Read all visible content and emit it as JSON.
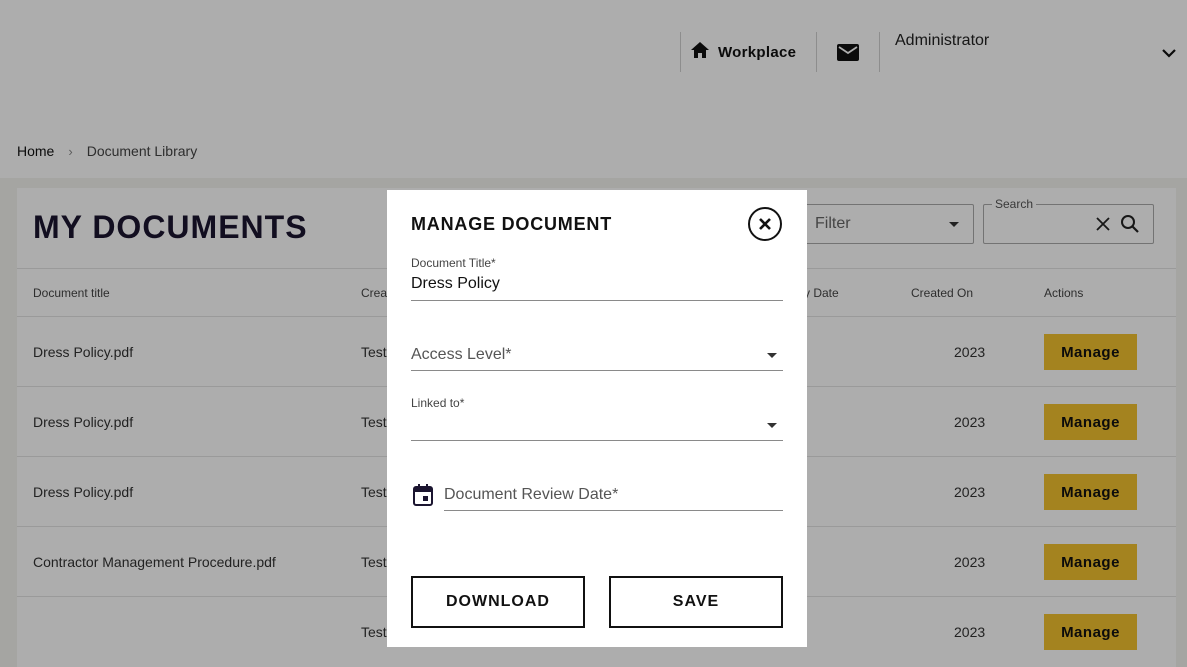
{
  "header": {
    "nav_workplace": "Workplace",
    "user_name": "Administrator"
  },
  "breadcrumb": {
    "home": "Home",
    "current": "Document Library"
  },
  "page": {
    "title": "MY DOCUMENTS",
    "filter_placeholder": "Filter",
    "search_label": "Search"
  },
  "table": {
    "columns": [
      "Document title",
      "Crea",
      "y Date",
      "Created On",
      "Actions"
    ],
    "rows": [
      {
        "title": "Dress Policy.pdf",
        "created_by": "Test",
        "review_date": "",
        "created_on": "2023",
        "action": "Manage"
      },
      {
        "title": "Dress Policy.pdf",
        "created_by": "Test",
        "review_date": "",
        "created_on": "2023",
        "action": "Manage"
      },
      {
        "title": "Dress Policy.pdf",
        "created_by": "Test",
        "review_date": "",
        "created_on": "2023",
        "action": "Manage"
      },
      {
        "title": "Contractor Management Procedure.pdf",
        "created_by": "Test",
        "review_date": "",
        "created_on": "2023",
        "action": "Manage"
      },
      {
        "title": "",
        "created_by": "Test",
        "review_date": "",
        "created_on": "2023",
        "action": "Manage"
      }
    ]
  },
  "modal": {
    "title": "MANAGE DOCUMENT",
    "doc_title_label": "Document Title*",
    "doc_title_value": "Dress Policy",
    "access_level_placeholder": "Access Level*",
    "linked_to_label": "Linked to*",
    "review_date_placeholder": "Document Review Date*",
    "download_label": "DOWNLOAD",
    "save_label": "SAVE"
  },
  "colors": {
    "accent": "#f2c12e",
    "title_ink": "#1b1530"
  }
}
